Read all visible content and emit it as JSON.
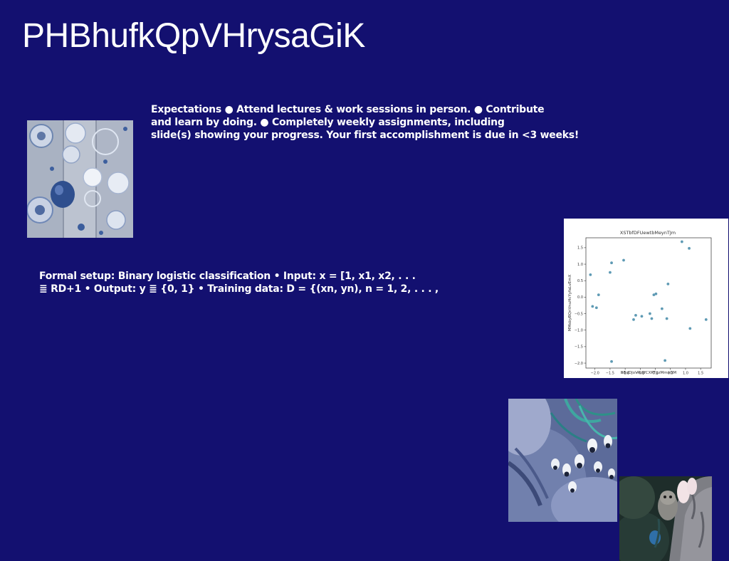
{
  "slide": {
    "title": "PHBhufkQpVHrysaGiK"
  },
  "expectations": {
    "lines": [
      "Expectations ● Attend lectures & work sessions in person. ● Contribute",
      "and learn by doing. ● Completely weekly assignments, including",
      "slide(s) showing your progress. Your first accomplishment is due in <3 weeks!"
    ]
  },
  "formal_setup": {
    "lines": [
      "Formal setup: Binary logistic classification • Input: x = [1, x1, x2, . . .",
      "≣ RD+1 • Output: y ≣ {0, 1} • Training data: D = {(xn, yn), n = 1, 2, . . . ,"
    ]
  },
  "images": {
    "ornaments": "glass-ornaments-photo",
    "feathers": "blue-feathers-photo",
    "owl": "owl-photo"
  },
  "chart_data": {
    "type": "scatter",
    "title": "XSTbfDFUewtbMeynTJm",
    "xlabel": "BBqDJoVRdJfCXRTgzMmeOM",
    "ylabel": "MMsbyBQnVnuHcYyfaLvEmX",
    "xlim": [
      -2.3,
      1.85
    ],
    "ylim": [
      -2.15,
      1.8
    ],
    "xticks": [
      -2.0,
      -1.5,
      -1.0,
      -0.5,
      0.0,
      0.5,
      1.0,
      1.5
    ],
    "yticks": [
      -2.0,
      -1.5,
      -1.0,
      -0.5,
      0.0,
      0.5,
      1.0,
      1.5
    ],
    "grid": false,
    "point_color": "#5e9ab4",
    "points": [
      [
        -2.15,
        0.68
      ],
      [
        -2.08,
        -0.28
      ],
      [
        -1.95,
        -0.32
      ],
      [
        -1.88,
        0.07
      ],
      [
        -1.5,
        0.75
      ],
      [
        -1.45,
        1.04
      ],
      [
        -1.45,
        -1.95
      ],
      [
        -1.05,
        1.12
      ],
      [
        -0.72,
        -0.68
      ],
      [
        -0.65,
        -0.55
      ],
      [
        -0.45,
        -0.58
      ],
      [
        -0.18,
        -0.5
      ],
      [
        -0.12,
        -0.65
      ],
      [
        -0.05,
        0.07
      ],
      [
        0.02,
        0.1
      ],
      [
        0.22,
        -0.35
      ],
      [
        0.32,
        -1.92
      ],
      [
        0.38,
        -0.65
      ],
      [
        0.42,
        0.4
      ],
      [
        0.88,
        1.68
      ],
      [
        1.12,
        1.48
      ],
      [
        1.15,
        -0.95
      ],
      [
        1.68,
        -0.68
      ]
    ]
  },
  "colors": {
    "background": "#131070",
    "text": "#ffffff",
    "chart_background": "#ffffff"
  }
}
